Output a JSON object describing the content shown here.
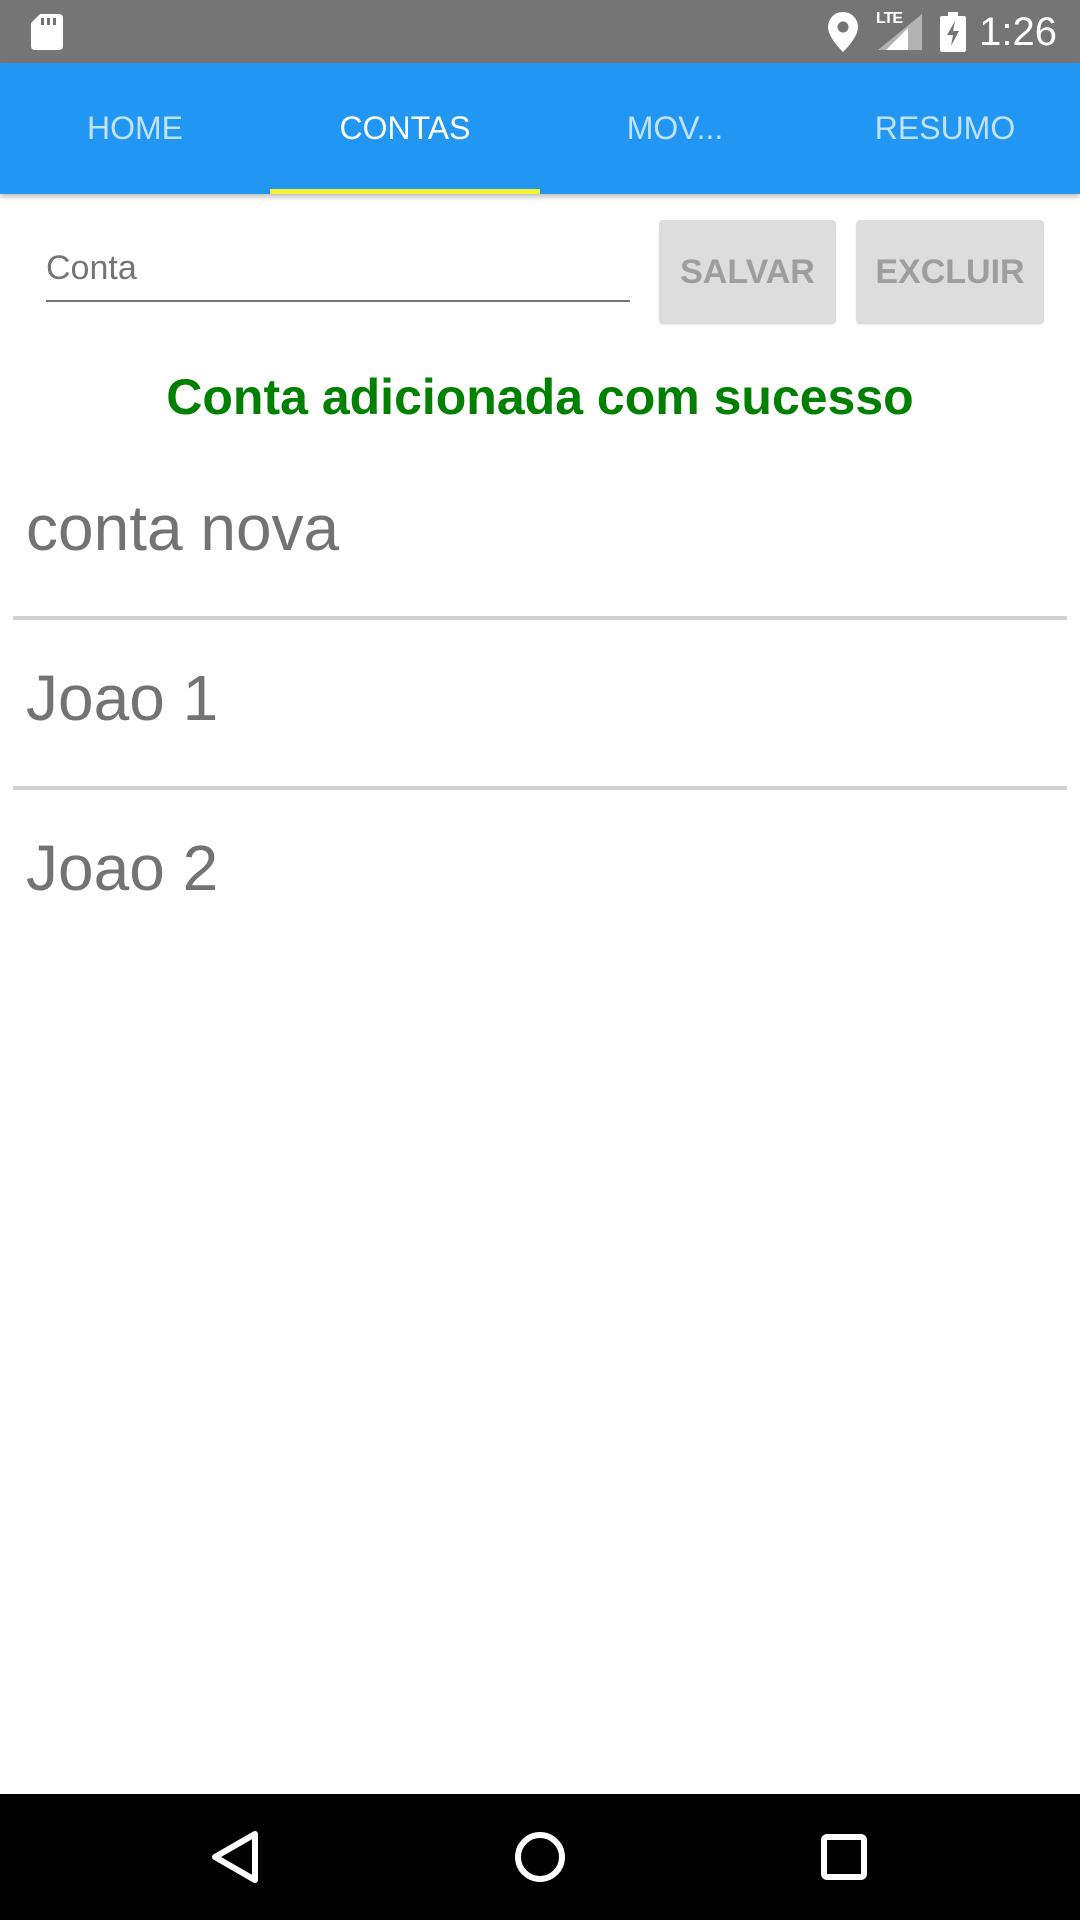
{
  "status_bar": {
    "network": "LTE",
    "time": "1:26"
  },
  "tabs": [
    {
      "label": "HOME",
      "active": false
    },
    {
      "label": "CONTAS",
      "active": true
    },
    {
      "label": "MOV...",
      "active": false
    },
    {
      "label": "RESUMO",
      "active": false
    }
  ],
  "form": {
    "account_placeholder": "Conta",
    "account_value": "",
    "save_label": "SALVAR",
    "delete_label": "EXCLUIR"
  },
  "status_message": "Conta adicionada com sucesso",
  "accounts": [
    {
      "name": "conta nova"
    },
    {
      "name": "Joao 1"
    },
    {
      "name": "Joao 2"
    }
  ],
  "colors": {
    "primary": "#2196f3",
    "tab_indicator": "#f2f23a",
    "success": "#008000",
    "status_bar": "#757575",
    "button_bg": "#dddddd"
  },
  "icons": {
    "status_bar": [
      "sd-card-icon",
      "location-icon",
      "signal-icon",
      "battery-charging-icon"
    ],
    "navigation": [
      "back-icon",
      "home-icon",
      "recent-apps-icon"
    ]
  }
}
